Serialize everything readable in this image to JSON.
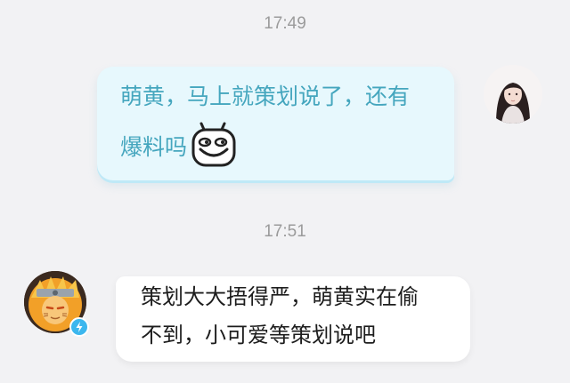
{
  "chat": {
    "messages": [
      {
        "time": "17:49",
        "sender": "me",
        "lines": [
          "萌黄，马上就策划说了，还有",
          "爆料吗"
        ],
        "sticker": "grinning-face-sticker"
      },
      {
        "time": "17:51",
        "sender": "other",
        "lines": [
          "策划大大捂得严，萌黄实在偷",
          "不到，小可爱等策划说吧"
        ],
        "badge": "verified-badge"
      }
    ]
  },
  "colors": {
    "background": "#f2f2f4",
    "outgoing_bubble": "#e7f8fd",
    "outgoing_text": "#45a6be",
    "incoming_bubble": "#ffffff",
    "incoming_text": "#1d1d1d",
    "timestamp": "#9b9b9b",
    "verified_badge": "#3cb7ee"
  }
}
